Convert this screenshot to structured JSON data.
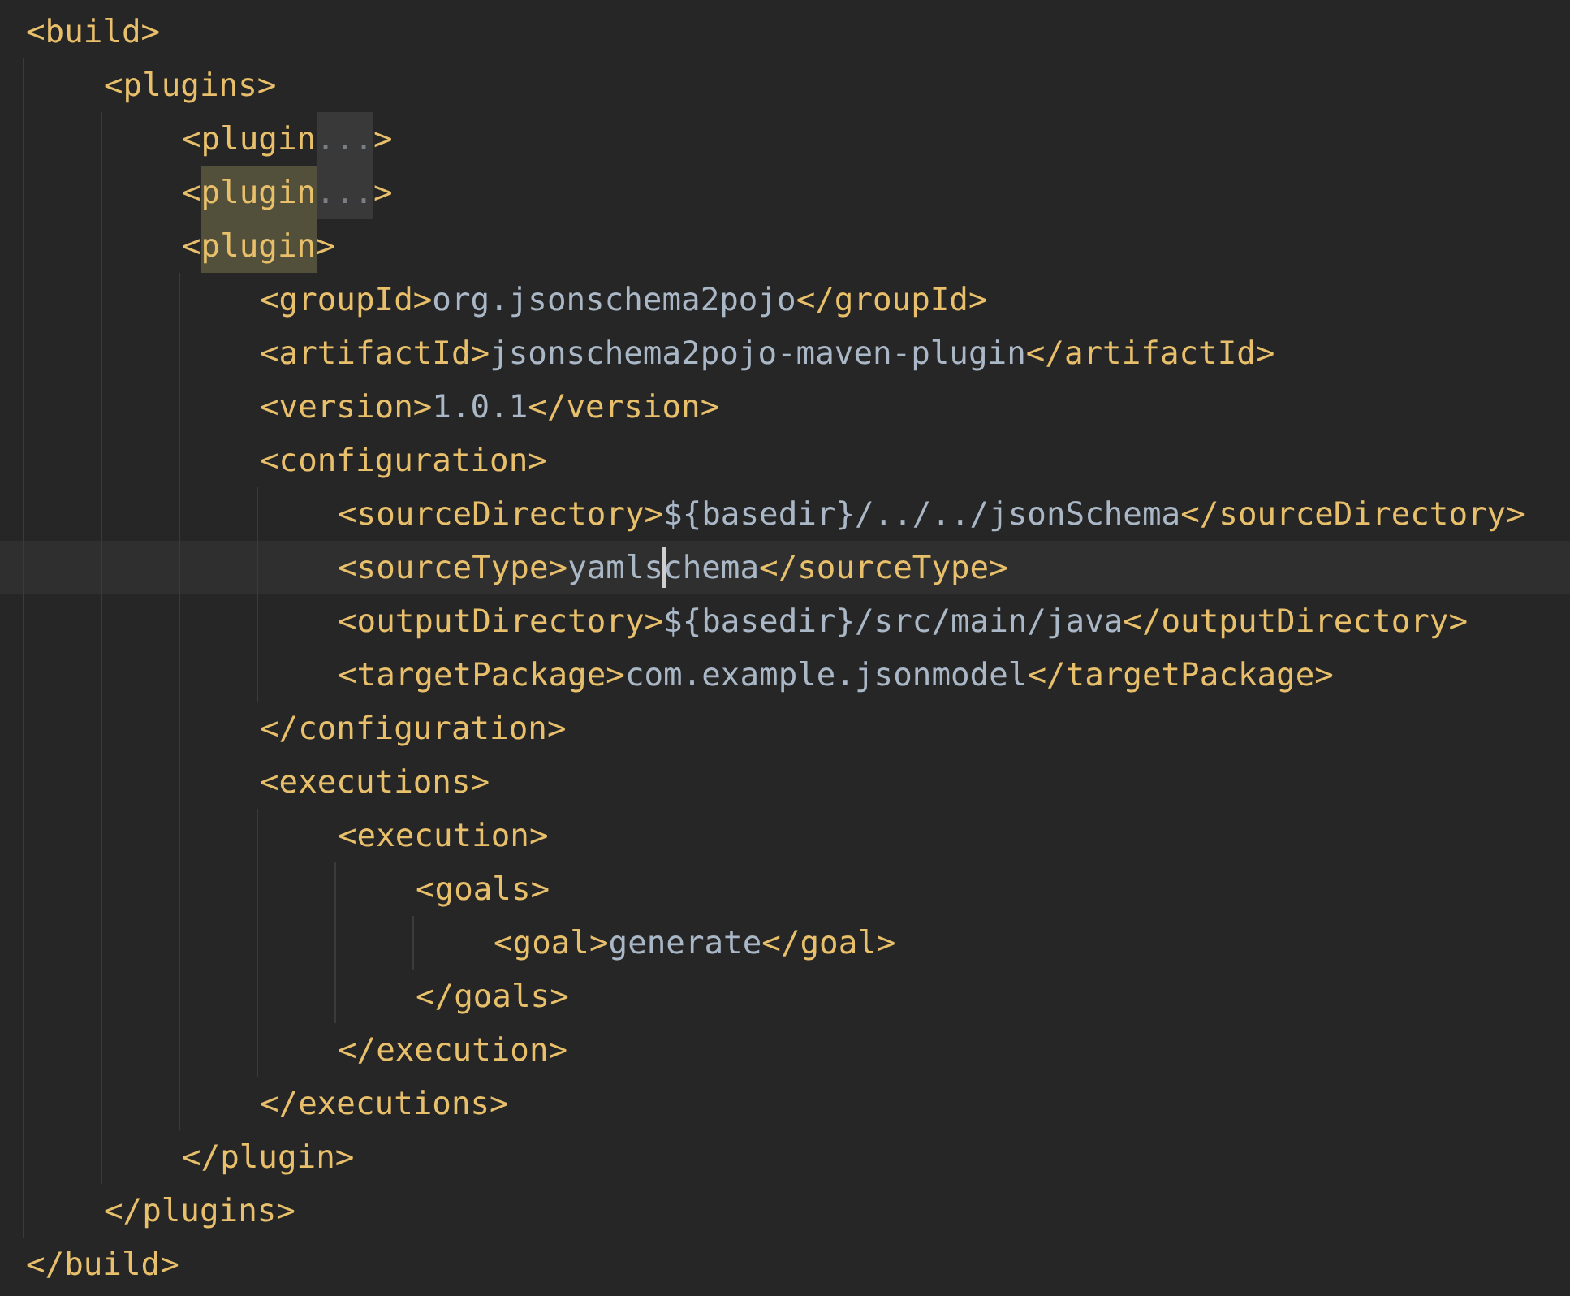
{
  "editor": {
    "root": {
      "open": [
        {
          "kind": "tag",
          "text": "<build>"
        }
      ],
      "children": [
        {
          "open": [
            {
              "kind": "tag",
              "text": "<plugins>"
            }
          ],
          "children": [
            {
              "line": [
                {
                  "kind": "tag",
                  "text": "<plugin"
                },
                {
                  "kind": "fold",
                  "text": "..."
                },
                {
                  "kind": "tag",
                  "text": ">"
                }
              ]
            },
            {
              "line": [
                {
                  "kind": "tag",
                  "text": "<"
                },
                {
                  "kind": "tag",
                  "text": "plugin",
                  "highlighted": true
                },
                {
                  "kind": "fold",
                  "text": "..."
                },
                {
                  "kind": "tag",
                  "text": ">"
                }
              ]
            },
            {
              "open": [
                {
                  "kind": "tag",
                  "text": "<"
                },
                {
                  "kind": "tag",
                  "text": "plugin",
                  "highlighted": true
                },
                {
                  "kind": "tag",
                  "text": ">"
                }
              ],
              "children": [
                {
                  "line": [
                    {
                      "kind": "tag",
                      "text": "<groupId>"
                    },
                    {
                      "kind": "text",
                      "text": "org.jsonschema2pojo"
                    },
                    {
                      "kind": "tag",
                      "text": "</groupId>"
                    }
                  ]
                },
                {
                  "line": [
                    {
                      "kind": "tag",
                      "text": "<artifactId>"
                    },
                    {
                      "kind": "text",
                      "text": "jsonschema2pojo-maven-plugin"
                    },
                    {
                      "kind": "tag",
                      "text": "</artifactId>"
                    }
                  ]
                },
                {
                  "line": [
                    {
                      "kind": "tag",
                      "text": "<version>"
                    },
                    {
                      "kind": "text",
                      "text": "1.0.1"
                    },
                    {
                      "kind": "tag",
                      "text": "</version>"
                    }
                  ]
                },
                {
                  "open": [
                    {
                      "kind": "tag",
                      "text": "<configuration>"
                    }
                  ],
                  "children": [
                    {
                      "line": [
                        {
                          "kind": "tag",
                          "text": "<sourceDirectory>"
                        },
                        {
                          "kind": "text",
                          "text": "${basedir}/../../jsonSchema"
                        },
                        {
                          "kind": "tag",
                          "text": "</sourceDirectory>"
                        }
                      ]
                    },
                    {
                      "line": [
                        {
                          "kind": "tag",
                          "text": "<sourceType>"
                        },
                        {
                          "kind": "text",
                          "text": "yamls",
                          "caret": true
                        },
                        {
                          "kind": "text",
                          "text": "chema"
                        },
                        {
                          "kind": "tag",
                          "text": "</sourceType>"
                        }
                      ]
                    },
                    {
                      "line": [
                        {
                          "kind": "tag",
                          "text": "<outputDirectory>"
                        },
                        {
                          "kind": "text",
                          "text": "${basedir}/src/main/java"
                        },
                        {
                          "kind": "tag",
                          "text": "</outputDirectory>"
                        }
                      ]
                    },
                    {
                      "line": [
                        {
                          "kind": "tag",
                          "text": "<targetPackage>"
                        },
                        {
                          "kind": "text",
                          "text": "com.example.jsonmodel"
                        },
                        {
                          "kind": "tag",
                          "text": "</targetPackage>"
                        }
                      ]
                    }
                  ],
                  "close": [
                    {
                      "kind": "tag",
                      "text": "</configuration>"
                    }
                  ]
                },
                {
                  "open": [
                    {
                      "kind": "tag",
                      "text": "<executions>"
                    }
                  ],
                  "children": [
                    {
                      "open": [
                        {
                          "kind": "tag",
                          "text": "<execution>"
                        }
                      ],
                      "children": [
                        {
                          "open": [
                            {
                              "kind": "tag",
                              "text": "<goals>"
                            }
                          ],
                          "children": [
                            {
                              "line": [
                                {
                                  "kind": "tag",
                                  "text": "<goal>"
                                },
                                {
                                  "kind": "text",
                                  "text": "generate"
                                },
                                {
                                  "kind": "tag",
                                  "text": "</goal>"
                                }
                              ]
                            }
                          ],
                          "close": [
                            {
                              "kind": "tag",
                              "text": "</goals>"
                            }
                          ]
                        }
                      ],
                      "close": [
                        {
                          "kind": "tag",
                          "text": "</execution>"
                        }
                      ]
                    }
                  ],
                  "close": [
                    {
                      "kind": "tag",
                      "text": "</executions>"
                    }
                  ]
                }
              ],
              "close": [
                {
                  "kind": "tag",
                  "text": "</plugin>"
                }
              ]
            }
          ],
          "close": [
            {
              "kind": "tag",
              "text": "</plugins>"
            }
          ]
        }
      ],
      "close": [
        {
          "kind": "tag",
          "text": "</build>"
        }
      ]
    }
  }
}
